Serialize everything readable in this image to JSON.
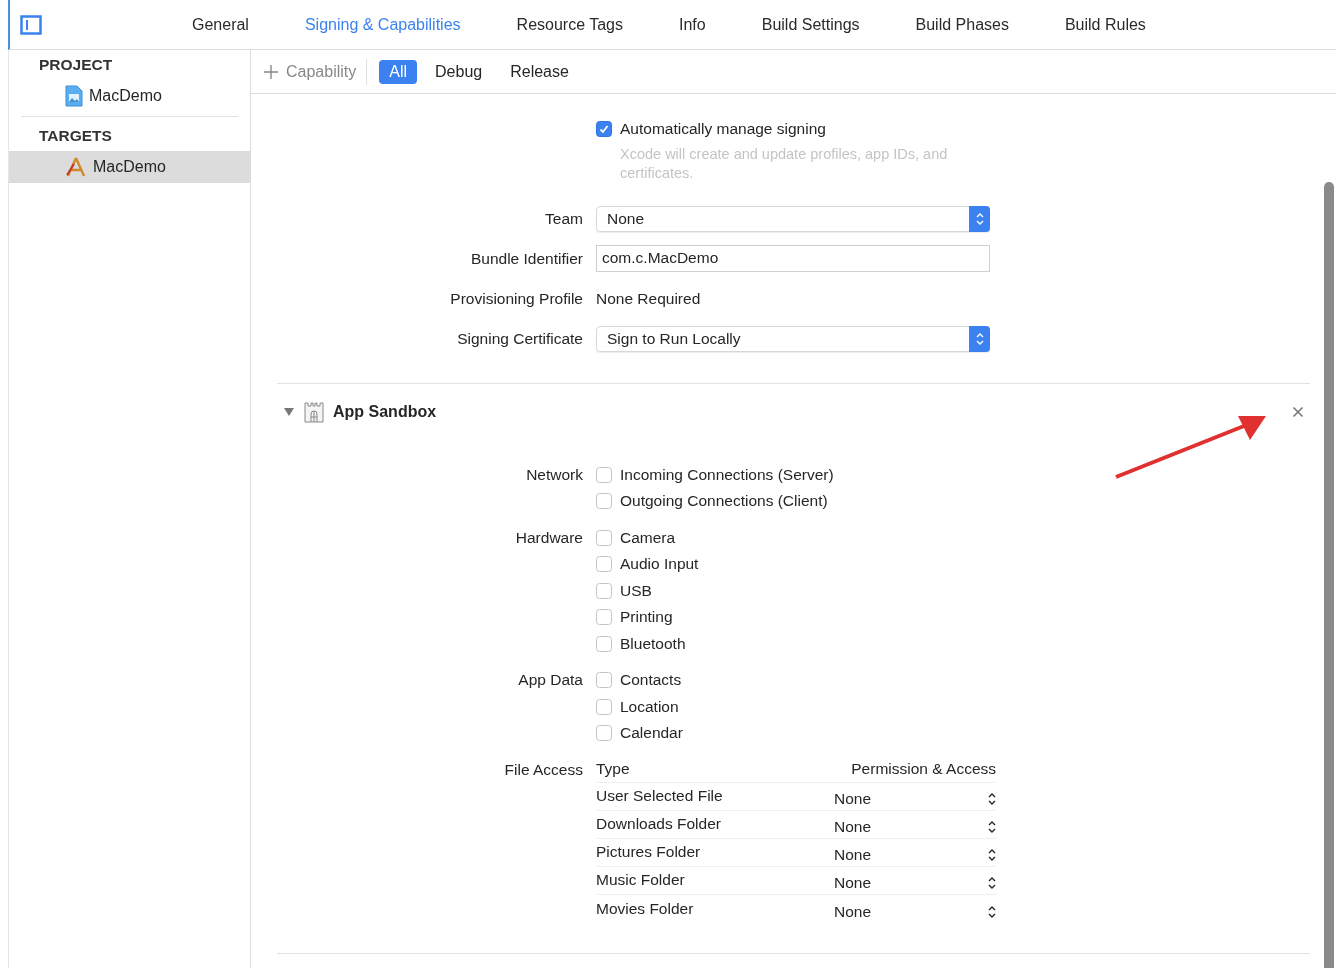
{
  "tabs": [
    {
      "label": "General",
      "selected": false
    },
    {
      "label": "Signing & Capabilities",
      "selected": true
    },
    {
      "label": "Resource Tags",
      "selected": false
    },
    {
      "label": "Info",
      "selected": false
    },
    {
      "label": "Build Settings",
      "selected": false
    },
    {
      "label": "Build Phases",
      "selected": false
    },
    {
      "label": "Build Rules",
      "selected": false
    }
  ],
  "sidebar": {
    "sections": [
      {
        "title": "PROJECT",
        "items": [
          {
            "label": "MacDemo",
            "kind": "project",
            "selected": false
          }
        ]
      },
      {
        "title": "TARGETS",
        "items": [
          {
            "label": "MacDemo",
            "kind": "target",
            "selected": true
          }
        ]
      }
    ]
  },
  "filter_bar": {
    "add_button": "Capability",
    "filters": [
      {
        "label": "All",
        "selected": true
      },
      {
        "label": "Debug",
        "selected": false
      },
      {
        "label": "Release",
        "selected": false
      }
    ]
  },
  "signing": {
    "auto_manage": {
      "label": "Automatically manage signing",
      "checked": true,
      "note": "Xcode will create and update profiles, app IDs, and certificates."
    },
    "fields": [
      {
        "kind": "popup",
        "label": "Team",
        "value": "None"
      },
      {
        "kind": "text",
        "label": "Bundle Identifier",
        "value": "com.c.MacDemo"
      },
      {
        "kind": "static",
        "label": "Provisioning Profile",
        "value": "None Required"
      },
      {
        "kind": "popup",
        "label": "Signing Certificate",
        "value": "Sign to Run Locally"
      }
    ]
  },
  "sandbox": {
    "title": "App Sandbox",
    "expanded": true,
    "groups": [
      {
        "label": "Network",
        "options": [
          {
            "label": "Incoming Connections (Server)",
            "checked": false
          },
          {
            "label": "Outgoing Connections (Client)",
            "checked": false
          }
        ]
      },
      {
        "label": "Hardware",
        "options": [
          {
            "label": "Camera",
            "checked": false
          },
          {
            "label": "Audio Input",
            "checked": false
          },
          {
            "label": "USB",
            "checked": false
          },
          {
            "label": "Printing",
            "checked": false
          },
          {
            "label": "Bluetooth",
            "checked": false
          }
        ]
      },
      {
        "label": "App Data",
        "options": [
          {
            "label": "Contacts",
            "checked": false
          },
          {
            "label": "Location",
            "checked": false
          },
          {
            "label": "Calendar",
            "checked": false
          }
        ]
      }
    ],
    "file_access": {
      "label": "File Access",
      "columns": [
        "Type",
        "Permission & Access"
      ],
      "rows": [
        {
          "type": "User Selected File",
          "permission": "None"
        },
        {
          "type": "Downloads Folder",
          "permission": "None"
        },
        {
          "type": "Pictures Folder",
          "permission": "None"
        },
        {
          "type": "Music Folder",
          "permission": "None"
        },
        {
          "type": "Movies Folder",
          "permission": "None"
        }
      ]
    }
  }
}
